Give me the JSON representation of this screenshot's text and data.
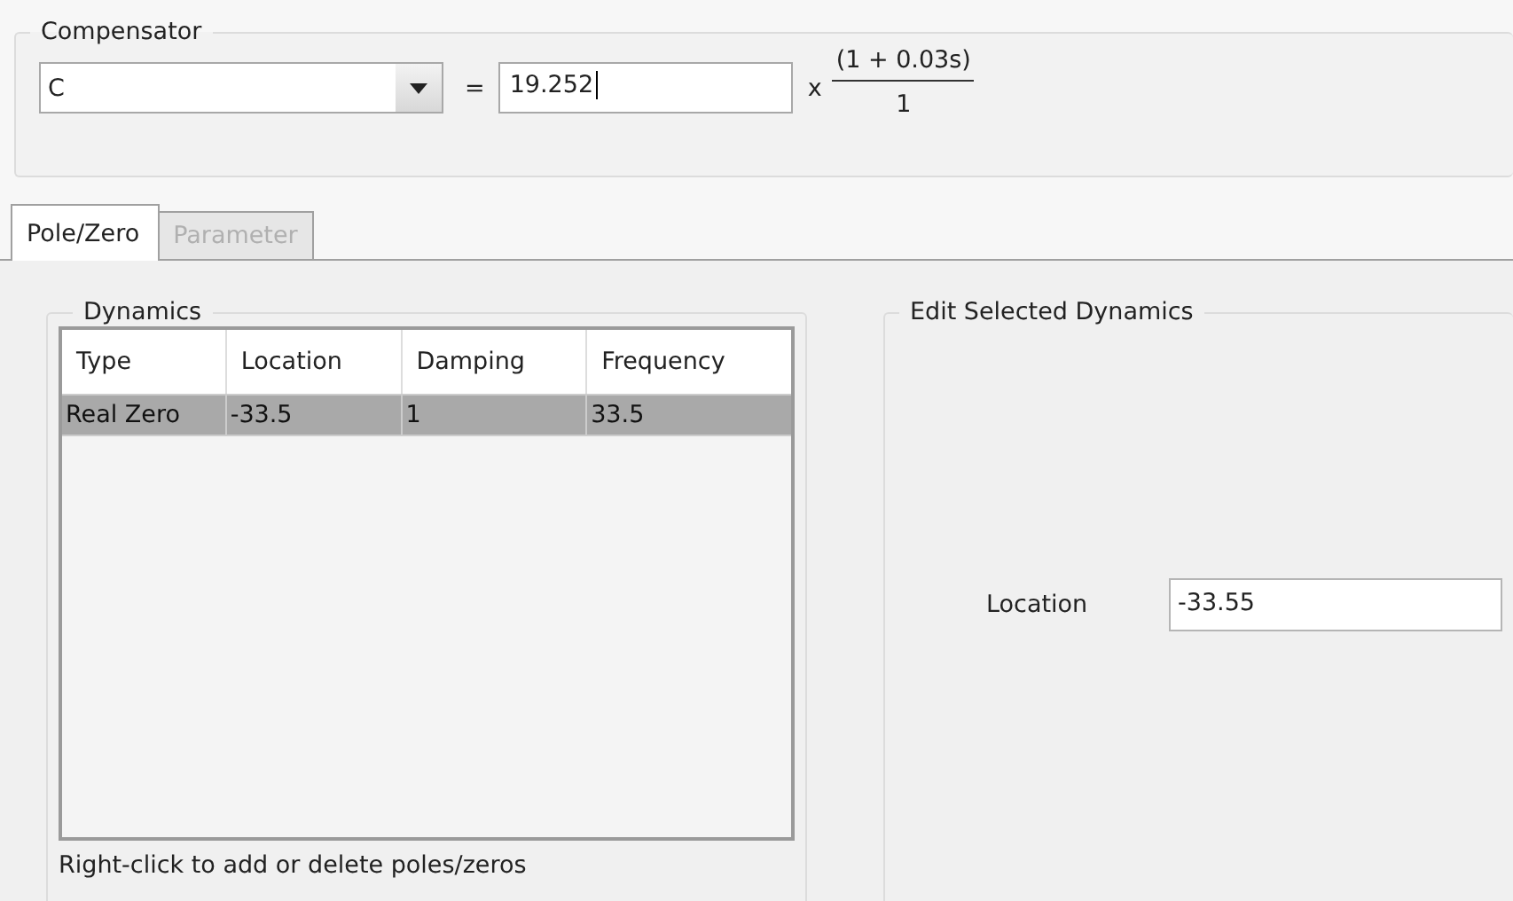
{
  "compensator": {
    "title": "Compensator",
    "name_field": {
      "value": "C"
    },
    "equals": "=",
    "gain_field": {
      "value": "19.252"
    },
    "times": "x",
    "numerator": "(1 + 0.03s)",
    "denominator": "1"
  },
  "tabs": [
    {
      "label": "Pole/Zero",
      "selected": true,
      "disabled": false
    },
    {
      "label": "Parameter",
      "selected": false,
      "disabled": true
    }
  ],
  "dynamics": {
    "title": "Dynamics",
    "table": {
      "columns": [
        "Type",
        "Location",
        "Damping",
        "Frequency"
      ],
      "rows": [
        {
          "cells": [
            "Real Zero",
            "-33.5",
            "1",
            "33.5"
          ],
          "selected": true
        }
      ]
    },
    "hint": "Right-click to add or delete poles/zeros"
  },
  "edit": {
    "title": "Edit Selected Dynamics",
    "fields": [
      {
        "label": "Location",
        "value": "-33.55"
      }
    ]
  }
}
